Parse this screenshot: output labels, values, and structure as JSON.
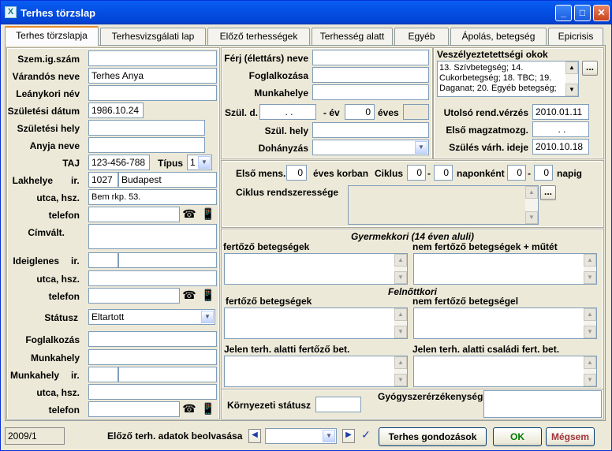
{
  "window": {
    "title": "Terhes törzslap",
    "app_icon": "x-app-icon"
  },
  "tabs": [
    "Terhes törzslapja",
    "Terhesvizsgálati lap",
    "Előző terhességek",
    "Terhesség alatt",
    "Egyéb",
    "Ápolás, betegség",
    "Epicrisis"
  ],
  "left": {
    "szem_ig_szam": {
      "label": "Szem.ig.szám",
      "value": ""
    },
    "varandos_neve": {
      "label": "Várandós neve",
      "value": "Terhes Anya"
    },
    "leanykori_nev": {
      "label": "Leánykori név",
      "value": ""
    },
    "szuletesi_datum": {
      "label": "Születési dátum",
      "value": "1986.10.24"
    },
    "szuletesi_hely": {
      "label": "Születési hely",
      "value": ""
    },
    "anyja_neve": {
      "label": "Anyja neve",
      "value": ""
    },
    "taj": {
      "label": "TAJ",
      "value": "123-456-788"
    },
    "tipus": {
      "label": "Típus",
      "value": "1"
    },
    "lakhelye": {
      "label": "Lakhelye",
      "ir_label": "ir.",
      "ir": "1027",
      "city": "Budapest"
    },
    "utca_hsz": {
      "label": "utca, hsz.",
      "value": "Bem rkp. 53."
    },
    "telefon": {
      "label": "telefon",
      "value": ""
    },
    "cimvalt": {
      "label": "Címvált."
    },
    "ideiglenes": {
      "label": "Ideiglenes",
      "ir_label": "ir.",
      "ir": "",
      "city": ""
    },
    "ideig_utca": {
      "label": "utca, hsz.",
      "value": ""
    },
    "ideig_telefon": {
      "label": "telefon",
      "value": ""
    },
    "statusz": {
      "label": "Státusz",
      "value": "Eltartott"
    },
    "foglalkozas": {
      "label": "Foglalkozás",
      "value": ""
    },
    "munkahely": {
      "label": "Munkahely",
      "value": ""
    },
    "munkahely_ir": {
      "label": "Munkahely",
      "ir_label": "ir.",
      "ir": "",
      "city": ""
    },
    "munka_utca": {
      "label": "utca, hsz.",
      "value": ""
    },
    "munka_telefon": {
      "label": "telefon",
      "value": ""
    }
  },
  "middle": {
    "ferj_neve": {
      "label": "Férj (élettárs) neve",
      "value": ""
    },
    "foglalkozasa": {
      "label": "Foglalkozása",
      "value": ""
    },
    "munkahelye": {
      "label": "Munkahelye",
      "value": ""
    },
    "szul_d": {
      "label": "Szül. d.",
      "value": ". .",
      "ev_label": "- év",
      "ev": "0",
      "eves_label": "éves"
    },
    "szul_hely": {
      "label": "Szül. hely",
      "value": ""
    },
    "dohanyzas": {
      "label": "Dohányzás",
      "value": ""
    }
  },
  "right": {
    "veszely_title": "Veszélyeztetettségi okok",
    "veszely_text": "13. Szívbetegség; 14. Cukorbetegség; 18. TBC; 19. Daganat; 20. Egyéb betegség;",
    "more": "...",
    "utolso_rend": {
      "label": "Utolsó rend.vérzés",
      "value": "2010.01.11"
    },
    "elso_magzat": {
      "label": "Első magzatmozg.",
      "value": ". ."
    },
    "szules_varh": {
      "label": "Szülés várh. ideje",
      "value": "2010.10.18"
    }
  },
  "cycle": {
    "elso_mens_label": "Első mens.",
    "elso_mens": "0",
    "eves_korban": "éves korban",
    "ciklus_label": "Ciklus",
    "ciklus_from": "0",
    "dash": "-",
    "ciklus_to": "0",
    "naponkent": "naponként",
    "napig_from": "0",
    "napig_to": "0",
    "napig": "napig",
    "rendszeresseg_label": "Ciklus rendszeressége",
    "more": "..."
  },
  "illness": {
    "gyermekkori_title": "Gyermekkori (14 éven aluli)",
    "gy_fertozo": "fertőző betegségek",
    "gy_nem_fertozo": "nem fertőző betegségek + műtét",
    "felnottkori_title": "Felnőttkori",
    "f_fertozo": "fertőző betegségek",
    "f_nem_fertozo": "nem fertőző betegségel",
    "jelen_fertozo": "Jelen terh. alatti fertőző bet.",
    "jelen_csaladi": "Jelen terh. alatti családi fert. bet.",
    "kornyezeti": "Környezeti státusz",
    "gyogyszer": "Gyógyszerérzékenység"
  },
  "statusbar": {
    "record": "2009/1",
    "elozo_label": "Előző terh. adatok beolvasása",
    "terhes_gondozasok": "Terhes gondozások",
    "ok": "OK",
    "megsem": "Mégsem"
  },
  "colors": {
    "title_blue": "#0450e6",
    "tab_orange": "#e68b2c",
    "ok_green": "#007a00",
    "megsem_red": "#a0343c"
  }
}
